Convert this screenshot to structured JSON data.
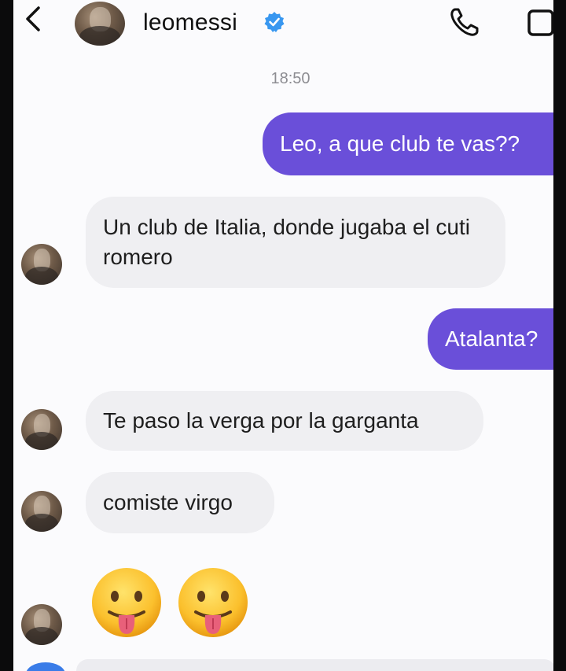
{
  "header": {
    "username": "leomessi",
    "verified": true,
    "accent": "#3897f0"
  },
  "timestamp": "18:50",
  "messages": [
    {
      "direction": "outgoing",
      "text": "Leo, a que club te vas??"
    },
    {
      "direction": "incoming",
      "text": "Un club de Italia, donde jugaba el cuti romero"
    },
    {
      "direction": "outgoing",
      "text": "Atalanta?"
    },
    {
      "direction": "incoming",
      "text": "Te paso la verga por la garganta"
    },
    {
      "direction": "incoming",
      "text": "comiste virgo"
    },
    {
      "direction": "incoming",
      "emoji": [
        "tongue-out-emoji",
        "tongue-out-emoji"
      ]
    }
  ],
  "colors": {
    "outgoing_bubble": "#6a4fd9",
    "incoming_bubble": "#efeff2",
    "background": "#fbfbfd"
  }
}
